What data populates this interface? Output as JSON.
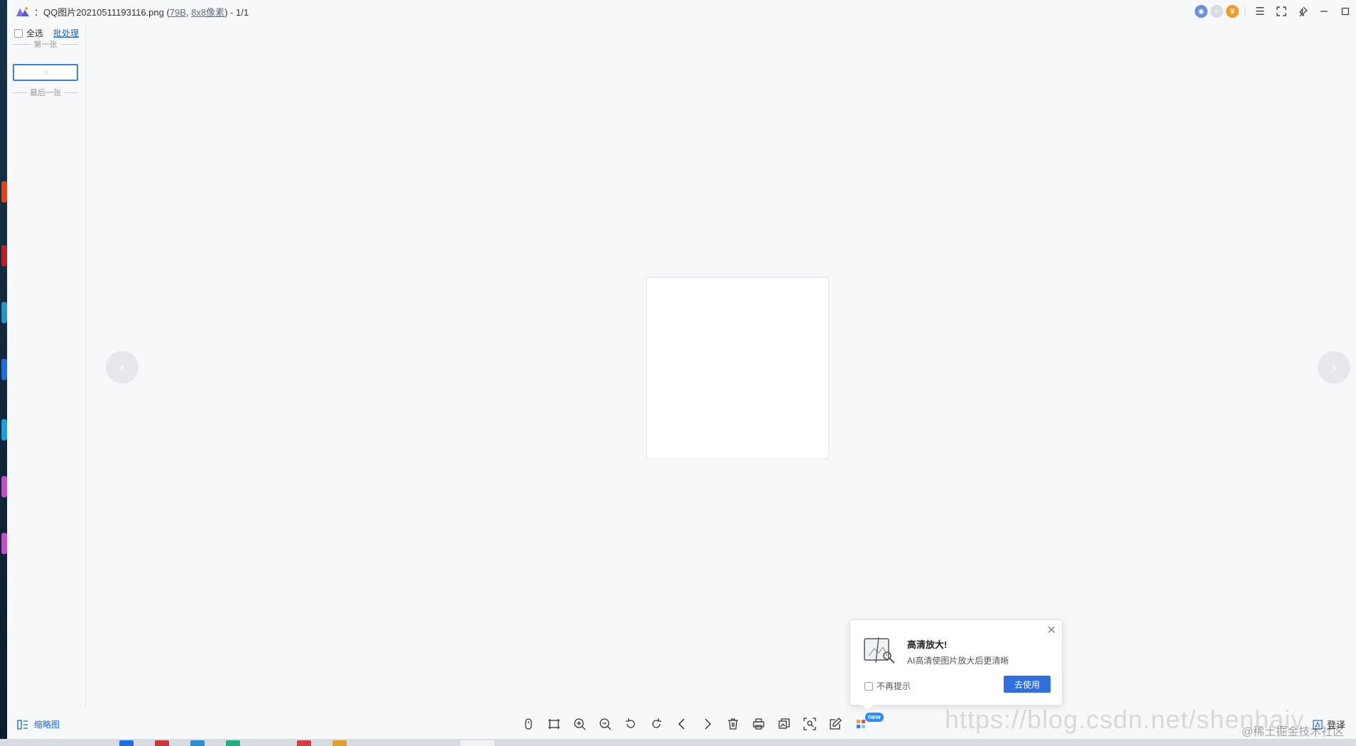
{
  "window": {
    "title_prefix": "：QQ图片20210511193116.png (",
    "file_size": "79B",
    "separator": ", ",
    "dimensions": "8x8像素",
    "title_suffix": ") - 1/1"
  },
  "left_panel": {
    "select_all_label": "全选",
    "batch_label": "批处理",
    "first_label": "第一张",
    "last_label": "最后一张"
  },
  "popup": {
    "title": "高清放大!",
    "description": "AI高清使图片放大后更清晰",
    "no_remind_label": "不再提示",
    "use_button": "去使用",
    "close_glyph": "✕"
  },
  "bottombar": {
    "thumbnail_label": "缩略图",
    "new_badge": "new",
    "right_label": "登译"
  },
  "watermark": {
    "url": "https://blog.csdn.net/shenhaiv",
    "community": "@稀土掘金技术社区"
  },
  "icons": {
    "prev_arrow": "‹",
    "next_arrow": "›"
  },
  "colors": {
    "accent": "#2f6fde",
    "link": "#1a64d8",
    "canvas_bg": "#f7f8fa"
  }
}
